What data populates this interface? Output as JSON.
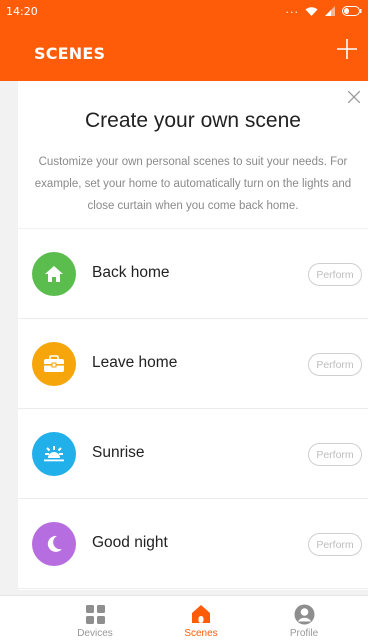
{
  "status_bar": {
    "time": "14:20",
    "dots": "..."
  },
  "appbar": {
    "title": "SCENES",
    "add_icon": "plus-icon"
  },
  "promo": {
    "title": "Create your own scene",
    "description": "Customize your own personal scenes to suit your needs. For example, set your home to automatically turn on the lights and close curtain when you come back home.",
    "close_icon": "close-icon"
  },
  "scenes": [
    {
      "name": "Back home",
      "icon": "home-icon",
      "color": "#5cbd4f",
      "action": "Perform"
    },
    {
      "name": "Leave home",
      "icon": "briefcase-icon",
      "color": "#f6a50a",
      "action": "Perform"
    },
    {
      "name": "Sunrise",
      "icon": "sunrise-icon",
      "color": "#21b0ea",
      "action": "Perform"
    },
    {
      "name": "Good night",
      "icon": "moon-icon",
      "color": "#b66de0",
      "action": "Perform"
    }
  ],
  "tabbar": {
    "tabs": [
      {
        "label": "Devices",
        "icon": "grid-icon",
        "active": false
      },
      {
        "label": "Scenes",
        "icon": "home-icon",
        "active": true
      },
      {
        "label": "Profile",
        "icon": "user-icon",
        "active": false
      }
    ]
  },
  "colors": {
    "accent": "#ff5c0a",
    "background": "#f2f2f2"
  }
}
